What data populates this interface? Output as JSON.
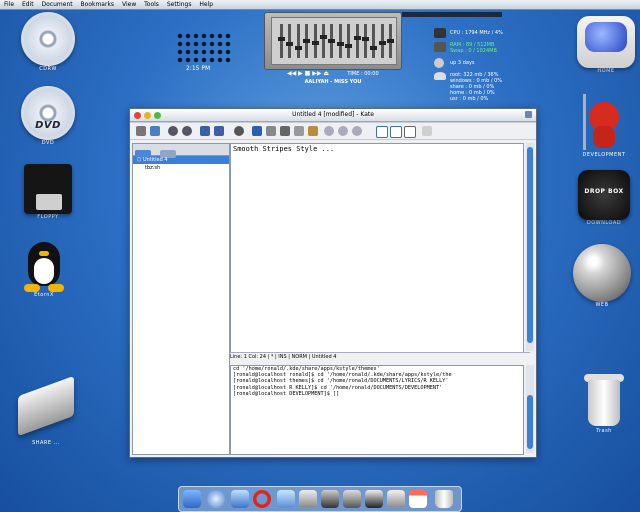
{
  "menubar": {
    "items": [
      "File",
      "Edit",
      "Document",
      "Bookmarks",
      "View",
      "Tools",
      "Settings",
      "Help"
    ]
  },
  "desktop_left": [
    {
      "label": "CDRW",
      "icon": "cdrw-icon"
    },
    {
      "label": "DVD",
      "icon": "dvd-icon"
    },
    {
      "label": "FLOPPY",
      "icon": "floppy-icon"
    },
    {
      "label": "EtornX",
      "icon": "tux-icon"
    },
    {
      "label": "SHARE ...",
      "icon": "drive-icon"
    }
  ],
  "desktop_right": [
    {
      "label": "HOME",
      "icon": "home-icon"
    },
    {
      "label": "DEVELOPMENT",
      "icon": "devil-icon"
    },
    {
      "label": "DOWNLOAD",
      "icon": "dropbox-icon"
    },
    {
      "label": "WEB",
      "icon": "globe-icon"
    },
    {
      "label": "Trash",
      "icon": "trash-icon"
    }
  ],
  "clock": {
    "time": "2:15 PM"
  },
  "player": {
    "time_label": "TIME : 00:00",
    "song": "AALIYAH - MISS YOU",
    "eq_levels": [
      0.55,
      0.4,
      0.3,
      0.5,
      0.45,
      0.62,
      0.5,
      0.4,
      0.35,
      0.6,
      0.55,
      0.3,
      0.45,
      0.5
    ]
  },
  "dropbox": {
    "label": "DROP BOX"
  },
  "sysmon": {
    "cpu": "CPU : 1794 MHz / 4%",
    "ram": "RAM : 89 / 512MB",
    "swap": "Swap : 0 / 1024MB",
    "uptime": "up 3 days",
    "disk_lines": [
      "root: 322 mb / 36%",
      "windows : 0 mb / 0%",
      "share : 0 mb / 0%",
      "home : 0 mb / 0%",
      "usr : 0 mb / 0%"
    ]
  },
  "kate": {
    "title": "Untitled 4 [modified] - Kate",
    "menu": [
      "File",
      "Edit",
      "Document",
      "Bookmarks",
      "View",
      "Tools",
      "Settings",
      "Help"
    ],
    "files": [
      "Untitled 4",
      "tbz.sh"
    ],
    "selected_file_index": 0,
    "editor_text": "Smooth Stripes Style ...",
    "status": "Line: 1 Col: 24 | * | INS | NORM | Untitled 4",
    "konsole_lines": [
      "cd '/home/ronald/.kde/share/apps/kstyle/themes'",
      "[ronald@localhost ronald]$ cd '/home/ronald/.kde/share/apps/kstyle/the",
      "[ronald@localhost themes]$ cd '/home/ronald/DOCUMENTS/LYRICS/R KELLY'",
      "[ronald@localhost R KELLY]$ cd '/home/ronald/DOCUMENTS/DEVELOPMENT'",
      "[ronald@localhost DEVELOPMENT]$ []"
    ]
  },
  "dock": {
    "items": [
      "finder-icon",
      "safari-icon",
      "preview-icon",
      "opera-icon",
      "itunes-icon",
      "mail-icon",
      "imovie-icon",
      "iphoto-icon",
      "terminal-icon",
      "keyboard-icon",
      "ical-icon",
      "trash-dock-icon"
    ]
  },
  "colors": {
    "accent": "#3d7fd6",
    "desktop": "#2c6fc4"
  }
}
